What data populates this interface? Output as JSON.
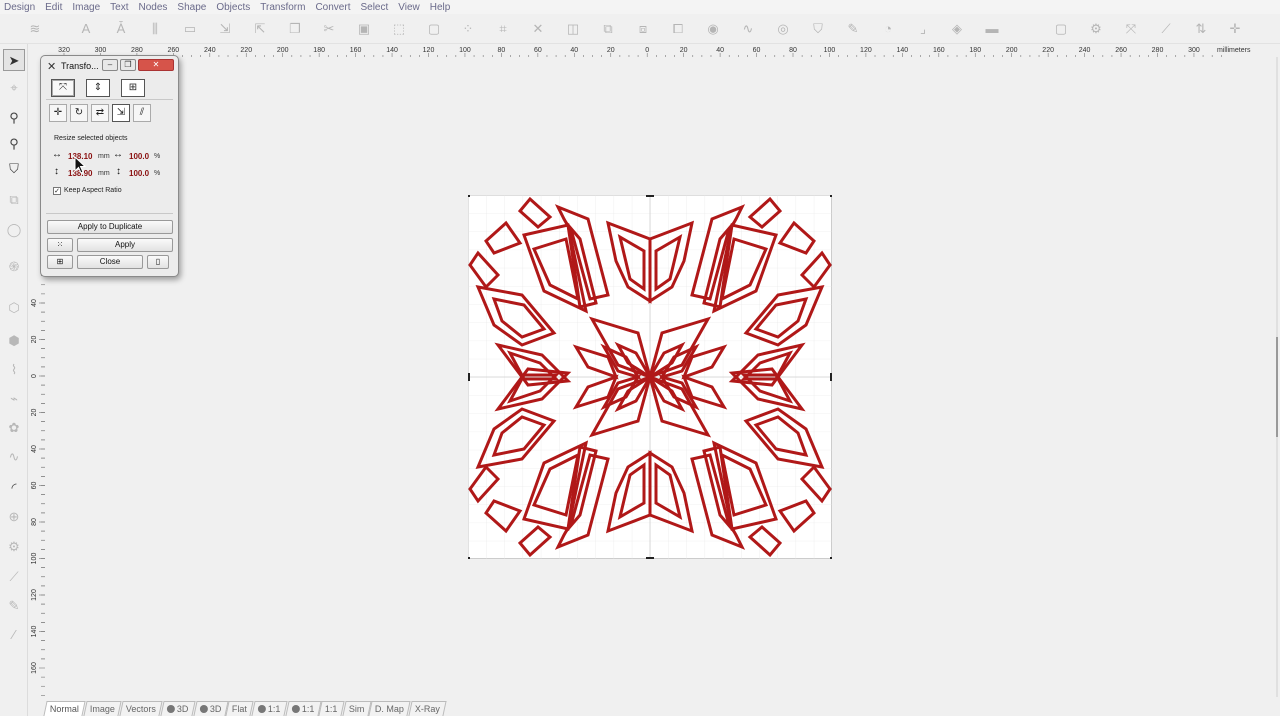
{
  "menu": [
    "Design",
    "Edit",
    "Image",
    "Text",
    "Nodes",
    "Shape",
    "Objects",
    "Transform",
    "Convert",
    "Select",
    "View",
    "Help"
  ],
  "ruler": {
    "units_label": "millimeters",
    "h_labels": [
      "320",
      "300",
      "280",
      "260",
      "240",
      "220",
      "200",
      "180",
      "160",
      "140",
      "120",
      "100",
      "80",
      "60",
      "40",
      "20",
      "0",
      "20",
      "40",
      "60",
      "80",
      "100",
      "120",
      "140",
      "160",
      "180",
      "200",
      "220",
      "240",
      "260",
      "280",
      "300"
    ],
    "v_labels": [
      "40",
      "20",
      "0",
      "20",
      "40",
      "60",
      "80",
      "100",
      "120",
      "140",
      "160"
    ]
  },
  "dialog": {
    "title": "Transfo...",
    "heading": "Resize selected objects",
    "width_value": "138.10",
    "height_value": "138.90",
    "unit_mm": "mm",
    "width_percent": "100.0",
    "height_percent": "100.0",
    "unit_percent": "%",
    "keep_aspect_label": "Keep Aspect Ratio",
    "keep_aspect_checked": true,
    "apply_duplicate_label": "Apply to Duplicate",
    "apply_label": "Apply",
    "close_label": "Close"
  },
  "tabs": [
    "Normal",
    "Image",
    "Vectors",
    "3D",
    "3D",
    "Flat",
    "1:1",
    "1:1",
    "1:1",
    "Sim",
    "D. Map",
    "X-Ray"
  ],
  "colors": {
    "pattern_stroke": "#b01818",
    "value_text": "#8a1010"
  }
}
